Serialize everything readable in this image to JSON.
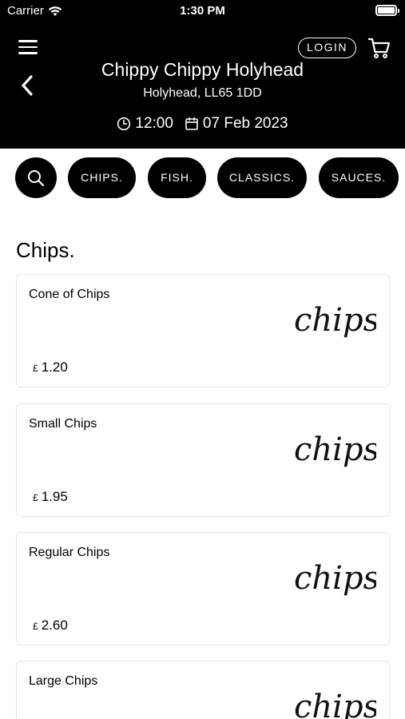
{
  "status_bar": {
    "carrier": "Carrier",
    "time": "1:30 PM"
  },
  "header": {
    "login_label": "LOGIN",
    "shop_name": "Chippy Chippy Holyhead",
    "address": "Holyhead, LL65 1DD",
    "order_time": "12:00",
    "order_date": "07 Feb 2023"
  },
  "categories": [
    "CHIPS.",
    "FISH.",
    "CLASSICS.",
    "SAUCES."
  ],
  "section": {
    "title": "Chips."
  },
  "products": [
    {
      "name": "Cone of Chips",
      "currency": "£",
      "price": "1.20",
      "image_text": "chips"
    },
    {
      "name": "Small Chips",
      "currency": "£",
      "price": "1.95",
      "image_text": "chips"
    },
    {
      "name": "Regular Chips",
      "currency": "£",
      "price": "2.60",
      "image_text": "chips"
    },
    {
      "name": "Large Chips",
      "currency": "£",
      "price": "",
      "image_text": "chips"
    }
  ]
}
